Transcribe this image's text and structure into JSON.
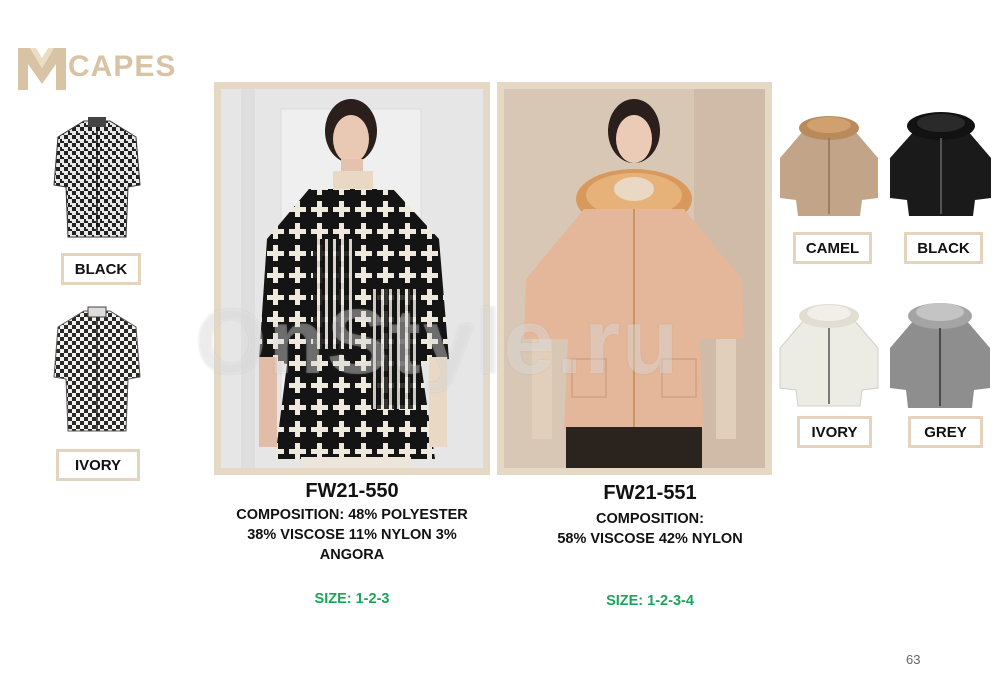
{
  "brand": {
    "logo_mark": "M",
    "logo_text": "CAPES",
    "logo_color": "#d8c3a5"
  },
  "watermark": "OnStyle.ru",
  "left_swatches": [
    {
      "label": "BLACK"
    },
    {
      "label": "IVORY"
    }
  ],
  "right_swatches": [
    {
      "label": "CAMEL"
    },
    {
      "label": "BLACK"
    },
    {
      "label": "IVORY"
    },
    {
      "label": "GREY"
    }
  ],
  "products": [
    {
      "code": "FW21-550",
      "composition_lines": [
        "COMPOSITION: 48% POLYESTER",
        "38% VISCOSE 11% NYLON 3%",
        "ANGORA"
      ],
      "size": "SIZE: 1-2-3"
    },
    {
      "code": "FW21-551",
      "composition_lines": [
        "COMPOSITION:",
        "58% VISCOSE 42% NYLON"
      ],
      "size": "SIZE: 1-2-3-4"
    }
  ],
  "page_number": "63",
  "colors": {
    "frame": "#e5d8c4",
    "label_border": "#e4d4bd",
    "size_text": "#1aa55a"
  }
}
